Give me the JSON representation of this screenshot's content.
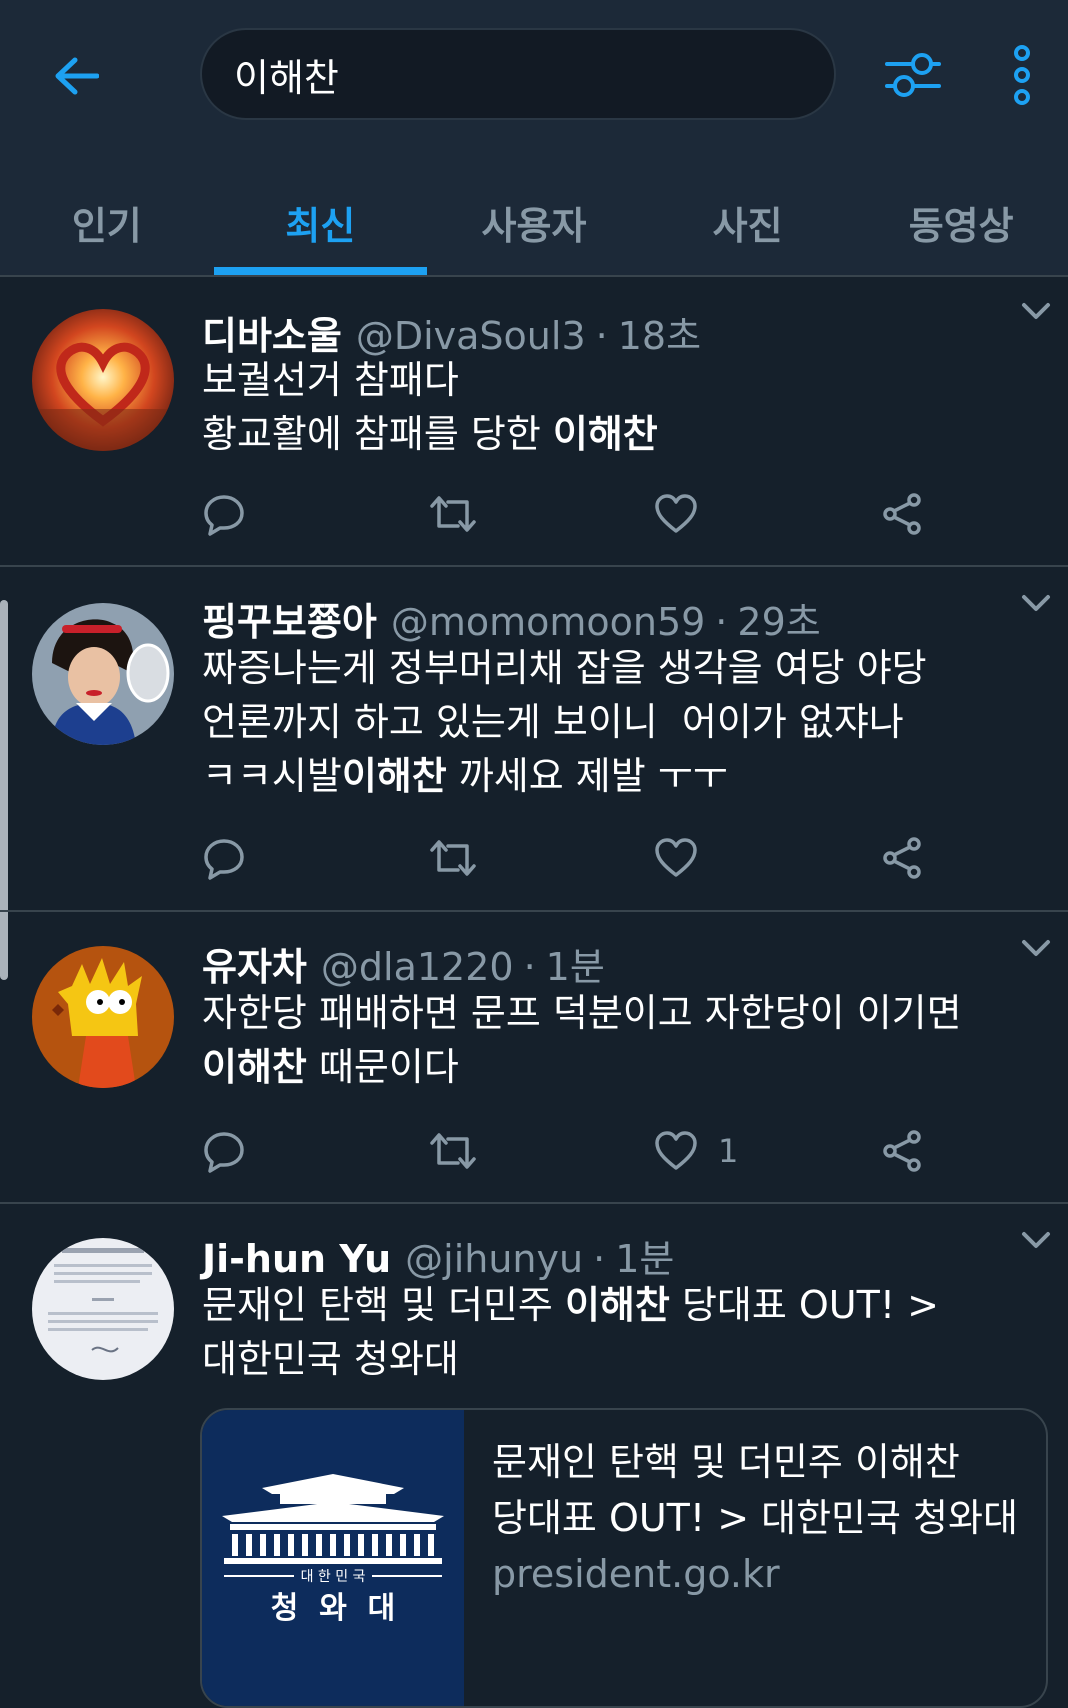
{
  "search": {
    "query": "이해찬"
  },
  "tabs": [
    "인기",
    "최신",
    "사용자",
    "사진",
    "동영상"
  ],
  "active_tab": "최신",
  "colors": {
    "accent": "#1da1f2",
    "background": "#15202b",
    "header": "#1c2938",
    "muted": "#8899a6"
  },
  "tweets": [
    {
      "name": "디바소울",
      "handle": "@DivaSoul3",
      "sep": "·",
      "time": "18초",
      "lines": [
        {
          "parts": [
            "보궐선거 참패다"
          ]
        },
        {
          "parts": [
            "황교활에 참패를 당한 ",
            "이해찬"
          ]
        }
      ],
      "like_count": ""
    },
    {
      "name": "핑꾸보쭁아",
      "handle": "@momomoon59",
      "sep": "·",
      "time": "29초",
      "lines": [
        {
          "parts": [
            "짜증나는게 정부머리채 잡을 생각을 여당 야당"
          ]
        },
        {
          "parts": [
            "언론까지 하고 있는게 보이니  어이가 없쟈나"
          ]
        },
        {
          "parts": [
            "ㅋㅋ시발",
            "이해찬",
            " 까세요 제발 ㅜㅜ"
          ]
        }
      ],
      "like_count": ""
    },
    {
      "name": "유자차",
      "handle": "@dla1220",
      "sep": "·",
      "time": "1분",
      "lines": [
        {
          "parts": [
            "자한당 패배하면 문프 덕분이고 자한당이 이기면"
          ]
        },
        {
          "parts": [
            "",
            "이해찬",
            " 때문이다"
          ]
        }
      ],
      "like_count": "1"
    },
    {
      "name": "Ji-hun Yu",
      "handle": "@jihunyu",
      "sep": "·",
      "time": "1분",
      "lines": [
        {
          "parts": [
            "문재인 탄핵 및 더민주 ",
            "이해찬",
            " 당대표 OUT! >"
          ]
        },
        {
          "parts": [
            "대한민국 청와대"
          ]
        }
      ],
      "like_count": ""
    }
  ],
  "card": {
    "title_line1": "문재인 탄핵 및 더민주 이해찬",
    "title_line2": "당대표 OUT! > 대한민국 청와대",
    "domain": "president.go.kr",
    "logo_small": "대 한 민 국",
    "logo_big": "청  와  대"
  }
}
